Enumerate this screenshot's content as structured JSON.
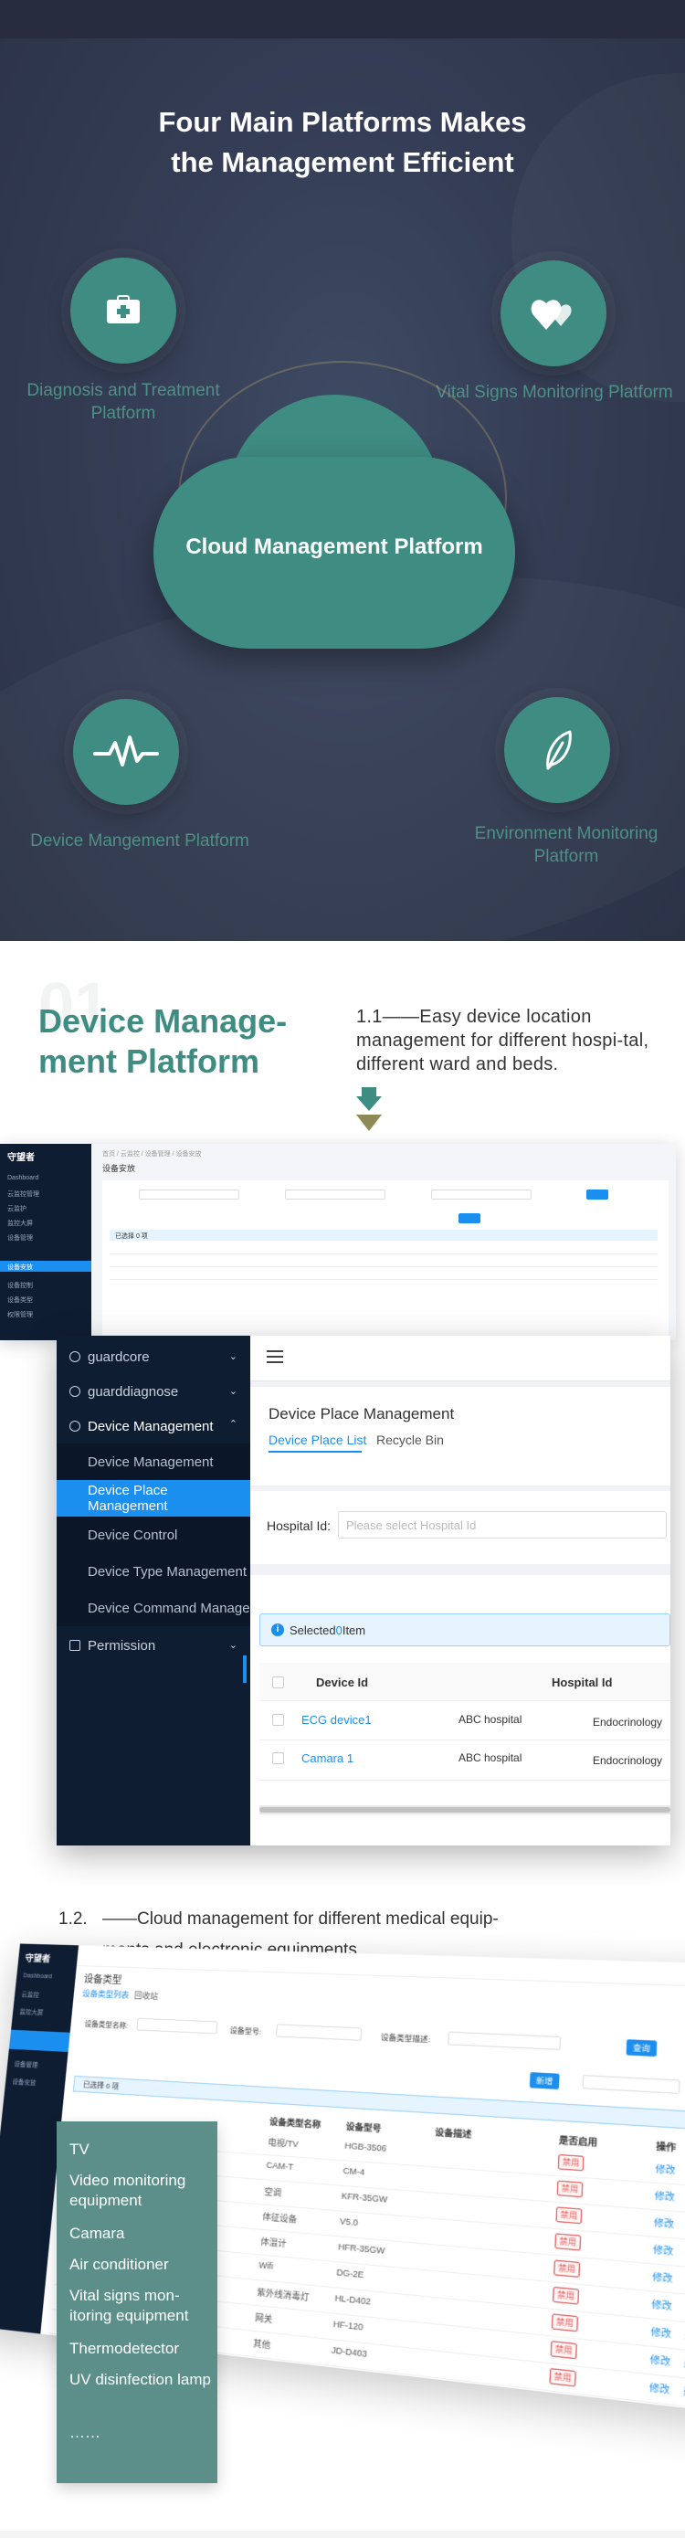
{
  "hero": {
    "title_line1": "Four Main Platforms Makes",
    "title_line2": "the Management Efficient",
    "center": "Cloud Management Platform",
    "nodes": [
      {
        "label": "Diagnosis and Treatment Platform",
        "icon": "medical-kit-icon"
      },
      {
        "label": "Vital Signs Monitoring Platform",
        "icon": "hearts-icon"
      },
      {
        "label": "Device Mangement Platform",
        "icon": "pulse-icon"
      },
      {
        "label": "Environment Monitoring Platform",
        "icon": "leaf-icon"
      }
    ]
  },
  "section1": {
    "number": "01",
    "title_line1": "Device Manage-",
    "title_line2": "ment Platform",
    "description": "1.1——Easy device location management for different hospi-tal, different ward and beds.",
    "colors": {
      "accent": "#3f8c82",
      "accent_arrow2": "#8e8a55"
    }
  },
  "bg_admin": {
    "logo": "守望者",
    "breadcrumb": "首页 / 云监控 / 设备管理 / 设备安放",
    "heading": "设备安放",
    "side_items": [
      "Dashboard",
      "云监控管理",
      "云监护",
      "监控大屏",
      "设备管理",
      "设备安放",
      "设备控制",
      "设备类型",
      "权限管理"
    ],
    "selected_info": "已选择 0 项"
  },
  "admin": {
    "sidebar": [
      {
        "label": "guardcore",
        "type": "group"
      },
      {
        "label": "guarddiagnose",
        "type": "group"
      },
      {
        "label": "Device Management",
        "type": "group-open"
      },
      {
        "label": "Device Management",
        "type": "sub"
      },
      {
        "label": "Device Place Management",
        "type": "sub-active"
      },
      {
        "label": "Device Control",
        "type": "sub"
      },
      {
        "label": "Device Type Management",
        "type": "sub"
      },
      {
        "label": "Device Command Management",
        "type": "sub"
      },
      {
        "label": "Permission",
        "type": "group"
      }
    ],
    "page_title": "Device Place Management",
    "tabs": [
      "Device Place List",
      "Recycle Bin"
    ],
    "filter_label": "Hospital Id:",
    "filter_placeholder": "Please select Hospital Id",
    "alert_text": "Selected",
    "alert_suffix": "Item",
    "columns": [
      "Device Id",
      "Hospital Id"
    ],
    "rows": [
      {
        "device": "ECG device1",
        "hospital": "ABC hospital",
        "dept": "Endocrinology"
      },
      {
        "device": "Camara 1",
        "hospital": "ABC hospital",
        "dept": "Endocrinology"
      }
    ]
  },
  "section2": {
    "number": "1.2.",
    "description_line1": "——Cloud management for different medical equip-",
    "description_line2": "ments and electronic equipments",
    "shot": {
      "logo": "守望者",
      "title": "设备类型",
      "tabs": [
        "设备类型列表",
        "回收站"
      ],
      "labels": [
        "设备类型名称:",
        "设备型号:",
        "设备类型描述:"
      ],
      "search_btn": "查询",
      "add_btn": "新增",
      "alert": "已选择 0 项",
      "columns": [
        "设备类型名称",
        "设备型号",
        "设备描述",
        "是否启用",
        "操作"
      ],
      "rows": [
        {
          "name": "电视/TV",
          "model": "HGB-3506",
          "status": "禁用"
        },
        {
          "name": "CAM-T",
          "model": "CM-4",
          "status": "禁用"
        },
        {
          "name": "空调",
          "model": "KFR-35GW",
          "status": "禁用"
        },
        {
          "name": "体征设备",
          "model": "V5.0",
          "status": "禁用"
        },
        {
          "name": "体温计",
          "model": "HFR-35GW",
          "status": "禁用"
        },
        {
          "name": "Wifi",
          "model": "DG-2E",
          "status": "禁用"
        },
        {
          "name": "紫外线消毒灯",
          "model": "HL-D402",
          "status": "禁用"
        },
        {
          "name": "网关",
          "model": "HF-120",
          "status": "禁用"
        },
        {
          "name": "其他",
          "model": "JD-D403",
          "status": "禁用"
        }
      ],
      "op_edit": "修改",
      "op_delete": "删除"
    },
    "equipments": [
      "TV",
      "Video monitoring equipment",
      "Camara",
      "Air conditioner",
      "Vital signs mon-itoring equipment",
      "Thermodetector",
      "UV disinfection lamp",
      "……"
    ]
  }
}
